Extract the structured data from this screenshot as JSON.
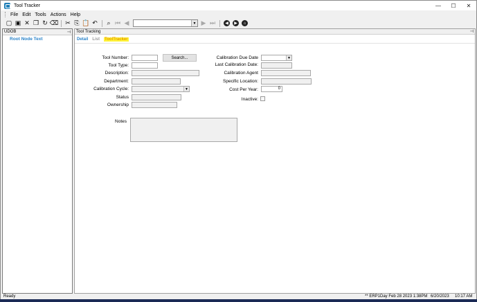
{
  "window": {
    "title": "Tool Tracker",
    "controls": [
      "—",
      "☐",
      "✕"
    ]
  },
  "menu": [
    "File",
    "Edit",
    "Tools",
    "Actions",
    "Help"
  ],
  "toolbar": {
    "record_selector_value": ""
  },
  "left_panel": {
    "header": "UDOB",
    "root_node": "Root Node Text",
    "pin_icon": "pin-icon"
  },
  "right_panel": {
    "header": "Tool Tracking",
    "tabs": {
      "detail": "Detail",
      "list": "List",
      "tool_tracker": "ToolTracker"
    },
    "fields": {
      "tool_number": {
        "label": "Tool Number:",
        "value": ""
      },
      "search_button": "Search...",
      "tool_type": {
        "label": "Tool Type:",
        "value": ""
      },
      "description": {
        "label": "Description:",
        "value": ""
      },
      "department": {
        "label": "Department:",
        "value": ""
      },
      "calibration_cycle": {
        "label": "Calibration Cycle:",
        "value": ""
      },
      "status": {
        "label": "Status",
        "value": ""
      },
      "ownership": {
        "label": "Ownership",
        "value": ""
      },
      "calibration_due_date": {
        "label": "Calibration Due Date",
        "value": ""
      },
      "last_calibration_date": {
        "label": "Last Calibration Date:",
        "value": ""
      },
      "calibration_agent": {
        "label": "Calibration Agent",
        "value": ""
      },
      "specific_location": {
        "label": "Specific Location:",
        "value": ""
      },
      "cost_per_year": {
        "label": "Cost Per Year:",
        "value": "0"
      },
      "inactive": {
        "label": "Inactive:",
        "checked": false
      },
      "notes": {
        "label": "Notes",
        "value": ""
      }
    }
  },
  "statusbar": {
    "ready": "Ready",
    "db_info": "** ERP1Day Feb 28 2023  1:38PM",
    "date": "6/20/2023",
    "time": "10:17 AM"
  }
}
